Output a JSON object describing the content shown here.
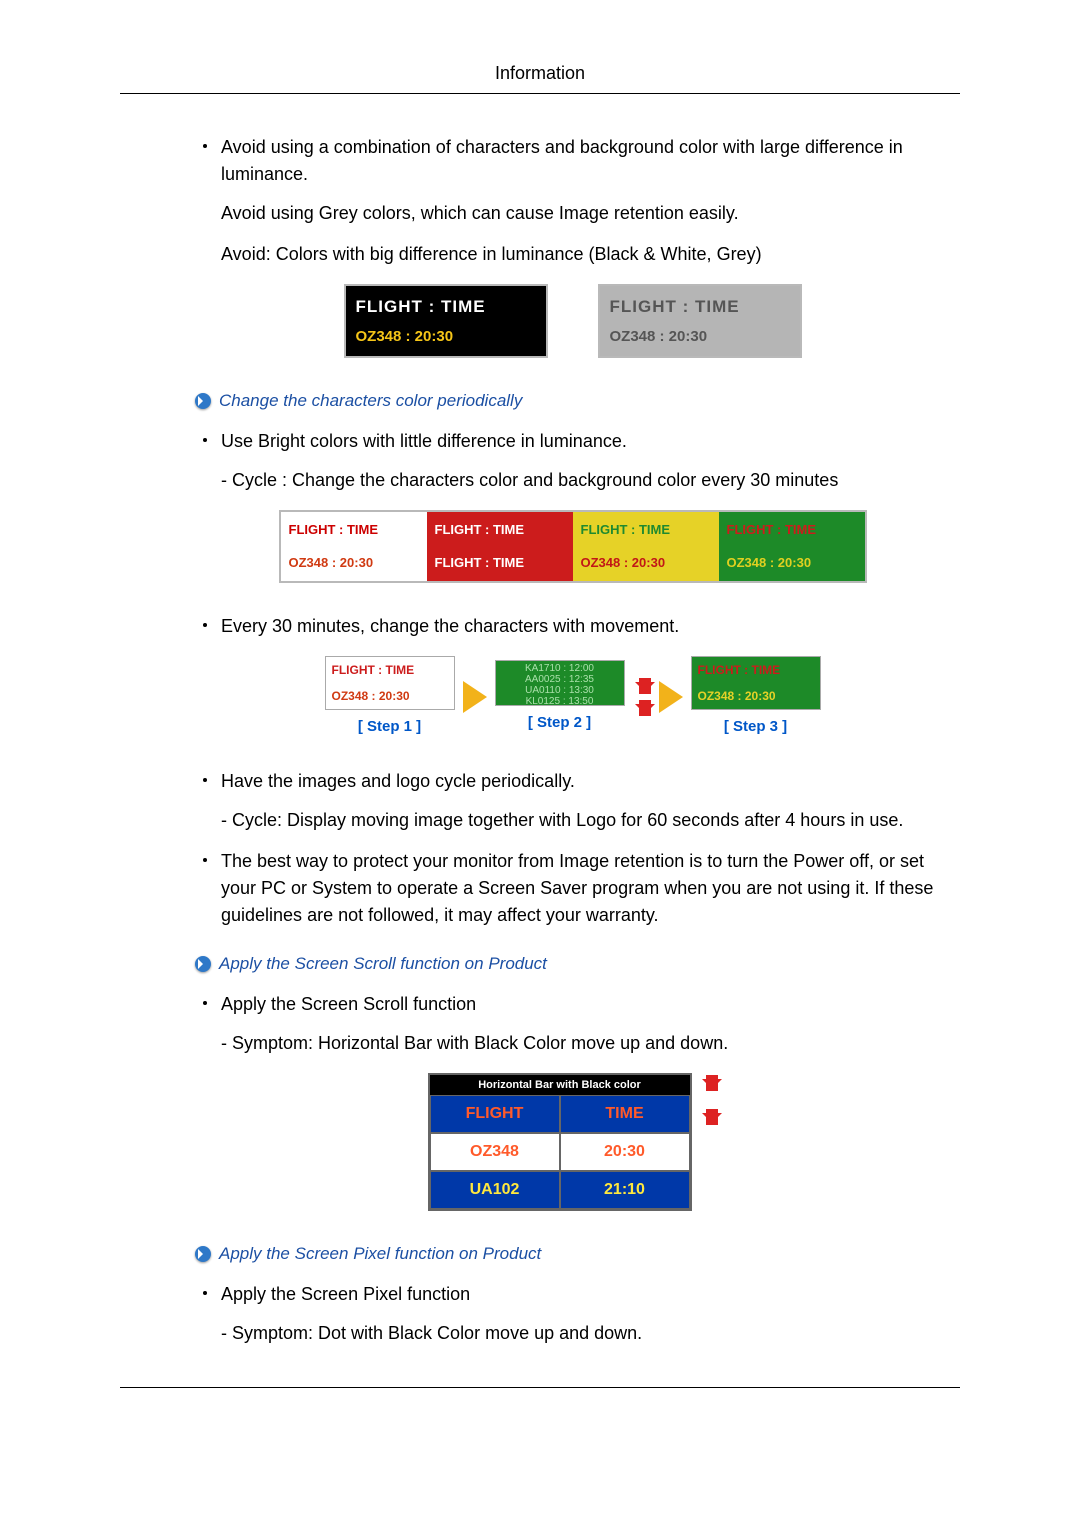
{
  "header": {
    "title": "Information"
  },
  "section1": {
    "b1": "Avoid using a combination of characters and background color with large difference in luminance.",
    "p1": "Avoid using Grey colors, which can cause Image retention easily.",
    "p2": "Avoid: Colors with big difference in luminance (Black & White, Grey)",
    "panel": {
      "flight_time": "FLIGHT  :  TIME",
      "flight_time_grey": "FLIGHT  :  TIME",
      "oz": "OZ348    :  20:30",
      "oz_grey": "OZ348    :  20:30"
    }
  },
  "section2": {
    "heading": "Change the characters color periodically",
    "b1": "Use Bright colors with little difference in luminance.",
    "sub1": "- Cycle : Change the characters color and background color every 30 minutes",
    "strip": {
      "c0_l1": "FLIGHT  :  TIME",
      "c0_l2": "OZ348    :  20:30",
      "c1_l1": "FLIGHT  :  TIME",
      "c1_l2": "FLIGHT  :  TIME",
      "c2_l1": "FLIGHT  :  TIME",
      "c2_l2": "OZ348    :  20:30",
      "c3_l1": "FLIGHT  :  TIME",
      "c3_l2": "OZ348    :  20:30"
    }
  },
  "section3": {
    "b1": "Every 30 minutes, change the characters with movement.",
    "steps": {
      "s1_l1": "FLIGHT  :  TIME",
      "s1_l2": "OZ348    :  20:30",
      "s1_label": "[  Step 1  ]",
      "s2_blob": "KA1710 : 12:00\nAA0025 : 12:35\nUA0110 : 13:30\nKL0125 : 13:50",
      "s2_label": "[  Step 2  ]",
      "s3_l1": "FLIGHT  :  TIME",
      "s3_l2": "OZ348    :  20:30",
      "s3_label": "[  Step 3  ]"
    }
  },
  "section4": {
    "b1": "Have the images and logo cycle periodically.",
    "sub1": "- Cycle: Display moving image together with Logo for 60 seconds after 4 hours in use.",
    "b2": "The best way to protect your monitor from Image retention is to turn the Power off, or set your PC or System to operate a Screen Saver program when you are not using it. If these guidelines are not followed, it may affect your warranty."
  },
  "section5": {
    "heading": "Apply the Screen Scroll function on Product",
    "b1": "Apply the Screen Scroll function",
    "sub1": "- Symptom: Horizontal Bar with Black Color move up and down.",
    "table": {
      "caption": "Horizontal Bar with Black color",
      "r1c1": "FLIGHT",
      "r1c2": "TIME",
      "r2c1": "OZ348",
      "r2c2": "20:30",
      "r3c1": "UA102",
      "r3c2": "21:10"
    }
  },
  "section6": {
    "heading": "Apply the Screen Pixel function on Product",
    "b1": "Apply the Screen Pixel function",
    "sub1": "- Symptom: Dot with Black Color move up and down."
  }
}
